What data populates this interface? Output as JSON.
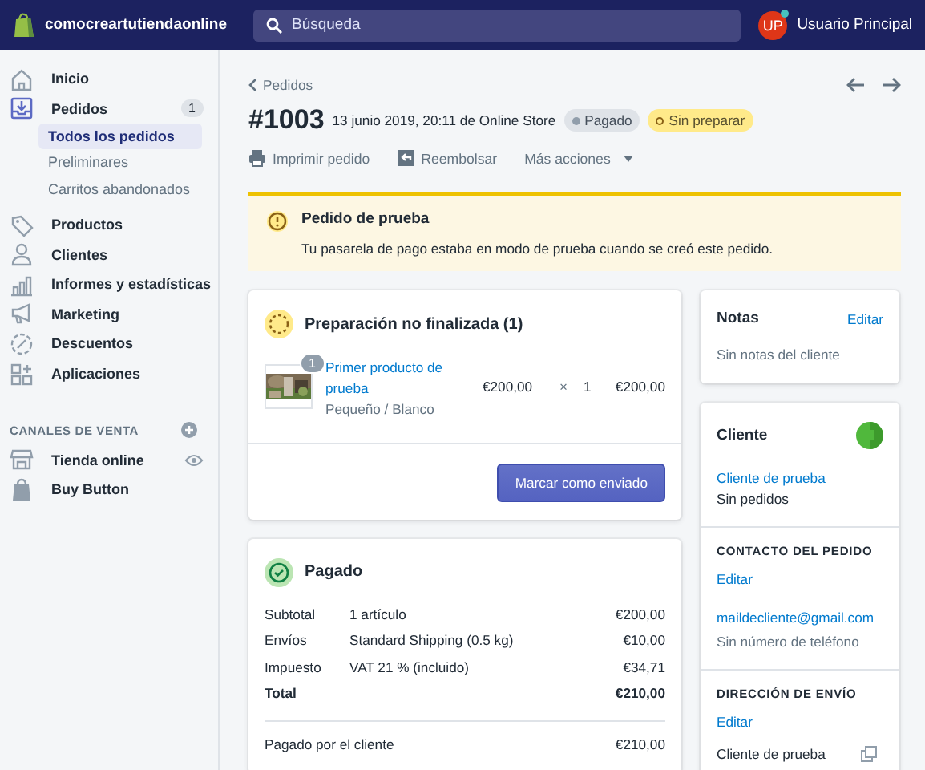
{
  "topbar": {
    "store_name": "comocreartutiendaonline",
    "search": {
      "placeholder": "Búsqueda"
    },
    "user": {
      "initials": "UP",
      "name": "Usuario Principal"
    }
  },
  "sidebar": {
    "items": [
      {
        "label": "Inicio",
        "selected": false
      },
      {
        "label": "Pedidos",
        "selected": true,
        "badge": "1",
        "children": [
          {
            "label": "Todos los pedidos",
            "selected": true
          },
          {
            "label": "Preliminares",
            "selected": false
          },
          {
            "label": "Carritos abandonados",
            "selected": false
          }
        ]
      },
      {
        "label": "Productos",
        "selected": false
      },
      {
        "label": "Clientes",
        "selected": false
      },
      {
        "label": "Informes y estadísticas",
        "selected": false
      },
      {
        "label": "Marketing",
        "selected": false
      },
      {
        "label": "Descuentos",
        "selected": false
      },
      {
        "label": "Aplicaciones",
        "selected": false
      }
    ],
    "channels": {
      "heading": "CANALES DE VENTA",
      "items": [
        {
          "label": "Tienda online"
        },
        {
          "label": "Buy Button"
        }
      ]
    }
  },
  "order": {
    "back": "Pedidos",
    "number": "#1003",
    "date": "13 junio 2019, 20:11 de Online Store",
    "badges": [
      {
        "label": "Pagado",
        "kind": "paid"
      },
      {
        "label": "Sin preparar",
        "kind": "unfulfilled"
      }
    ],
    "actions": [
      {
        "label": "Imprimir pedido",
        "kind": "print"
      },
      {
        "label": "Reembolsar",
        "kind": "refund"
      },
      {
        "label": "Más acciones",
        "kind": "menu"
      }
    ]
  },
  "banner": {
    "title": "Pedido de prueba",
    "text": "Tu pasarela de pago estaba en modo de prueba cuando se creó este pedido."
  },
  "fulfillment": {
    "title": "Preparación no finalizada (1)",
    "items": [
      {
        "quantity": "1",
        "name": "Primer producto de prueba",
        "variant": "Pequeño / Blanco",
        "price": "€200,00",
        "times": "×",
        "count": "1",
        "total": "€200,00"
      }
    ],
    "button": "Marcar como enviado"
  },
  "payment": {
    "title": "Pagado",
    "rows": [
      {
        "label": "Subtotal",
        "detail": "1 artículo",
        "amount": "€200,00",
        "kind": "line"
      },
      {
        "label": "Envíos",
        "detail": "Standard Shipping (0.5 kg)",
        "amount": "€10,00",
        "kind": "line"
      },
      {
        "label": "Impuesto",
        "detail": "VAT 21 % (incluido)",
        "amount": "€34,71",
        "kind": "line"
      },
      {
        "label": "Total",
        "amount": "€210,00",
        "kind": "total"
      }
    ],
    "paid": {
      "label": "Pagado por el cliente",
      "amount": "€210,00"
    }
  },
  "notes": {
    "title": "Notas",
    "edit": "Editar",
    "text": "Sin notas del cliente"
  },
  "customer": {
    "title": "Cliente",
    "name": "Cliente de prueba",
    "orders": "Sin pedidos",
    "contact": {
      "heading": "CONTACTO DEL PEDIDO",
      "edit": "Editar",
      "email": "maildecliente@gmail.com",
      "phone": "Sin número de teléfono"
    },
    "shipping": {
      "heading": "DIRECCIÓN DE ENVÍO",
      "edit": "Editar",
      "name": "Cliente de prueba"
    }
  }
}
